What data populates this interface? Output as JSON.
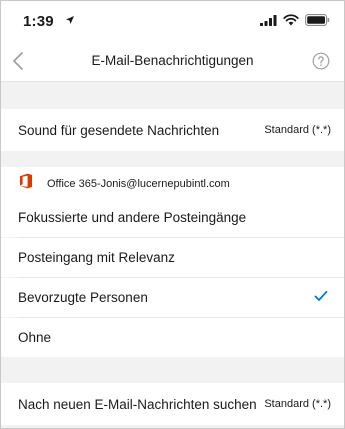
{
  "status_bar": {
    "time": "1:39"
  },
  "nav": {
    "title": "E-Mail-Benachrichtigungen"
  },
  "sound_sent": {
    "label": "Sound für gesendete Nachrichten",
    "value": "Standard (*.*)"
  },
  "account": {
    "label": "Office 365-Jonis@lucernepubintl.com",
    "icon": "office-icon"
  },
  "options": [
    {
      "label": "Fokussierte und andere Posteingänge",
      "selected": false
    },
    {
      "label": "Posteingang mit Relevanz",
      "selected": false
    },
    {
      "label": "Bevorzugte Personen",
      "selected": true
    },
    {
      "label": "Ohne",
      "selected": false
    }
  ],
  "new_mail_check": {
    "label": "Nach neuen E-Mail-Nachrichten suchen",
    "value": "Standard (*.*)"
  },
  "colors": {
    "accent": "#0078d4",
    "office_red": "#d83b01",
    "background": "#f2f2f2"
  }
}
